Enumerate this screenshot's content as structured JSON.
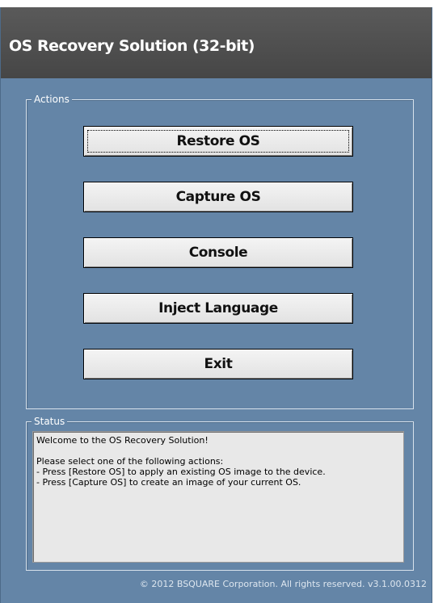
{
  "window": {
    "title": "OS Recovery Solution (32-bit)"
  },
  "actions": {
    "legend": "Actions",
    "buttons": [
      {
        "label": "Restore OS",
        "focused": true
      },
      {
        "label": "Capture OS"
      },
      {
        "label": "Console"
      },
      {
        "label": "Inject Language"
      },
      {
        "label": "Exit"
      }
    ]
  },
  "status": {
    "legend": "Status",
    "lines": [
      "Welcome to the OS Recovery Solution!",
      "",
      "Please select one of the following actions:",
      "- Press [Restore OS] to apply an existing OS image to the device.",
      "- Press [Capture OS] to create an image of your current OS."
    ]
  },
  "footer": {
    "copyright": "© 2012 BSQUARE Corporation. All rights reserved. v3.1.00.0312"
  },
  "colors": {
    "title_bar": "#4f4f4f",
    "window_background": "#6485a7",
    "button_face": "#ececec",
    "status_background": "#e8e8e8"
  }
}
